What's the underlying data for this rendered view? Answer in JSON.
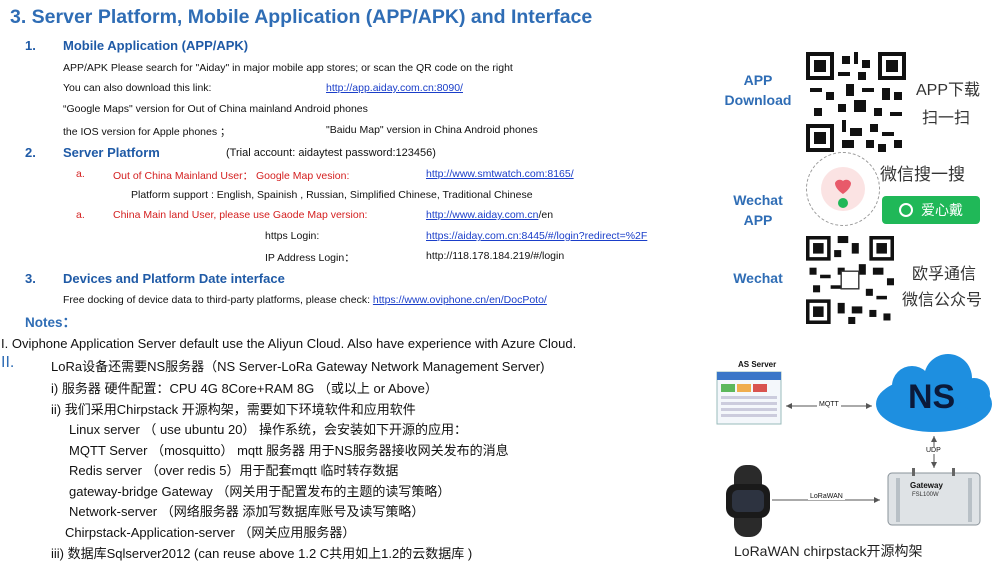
{
  "title": "3. Server Platform, Mobile Application (APP/APK) and Interface",
  "s1": {
    "num": "1.",
    "heading": "Mobile Application (APP/APK)",
    "line1": "APP/APK Please search for \"Aiday\" in major mobile app stores; or scan the QR code on the right",
    "line2_label": "You can also download this link:",
    "line2_link": "http://app.aiday.com.cn:8090/",
    "line3": "“Google Maps\" version for Out of China mainland Android phones",
    "line4a": "the IOS version for Apple phones ；",
    "line4b": "\"Baidu Map\" version in China Android phones"
  },
  "s2": {
    "num": "2.",
    "heading": "Server Platform",
    "trial": "(Trial account:   aidaytest           password:123456)",
    "a1_num": "a.",
    "a1_label": "Out of China Mainland User：  Google Map vesion:",
    "a1_link": "http://www.smtwatch.com:8165/",
    "support": "Platform support : English, Spainish , Russian, Simplified Chinese, Traditional Chinese",
    "a2_num": "a.",
    "a2_label": "China Main land User, please use Gaode Map version:",
    "a2_link": "http://www.aiday.com.cn",
    "a2_suffix": "/en",
    "https_label": "https Login:",
    "https_link": "https://aiday.com.cn:8445/#/login?redirect=%2F",
    "ip_label": "IP Address Login：",
    "ip_value": "http://118.178.184.219/#/login"
  },
  "s3": {
    "num": "3.",
    "heading": "Devices and Platform Date interface",
    "line_label": "Free docking of device data to third-party platforms, please check:",
    "line_link": "https://www.oviphone.cn/en/DocPoto/"
  },
  "notes": {
    "heading": "Notes：",
    "n1": "I.  Oviphone Application Server default use the Aliyun Cloud. Also have experience with Azure Cloud.",
    "n2_num": "II.",
    "n2": "LoRa设备还需要NS服务器（NS Server-LoRa Gateway Network Management Server)",
    "i1": "i)   服务器 硬件配置：CPU 4G 8Core+RAM 8G  （或以上 or Above）",
    "i2": "ii)  我们采用Chirpstack 开源构架，需要如下环境软件和应用软件",
    "l1": "Linux server  （ use ubuntu 20）  操作系统，会安装如下开源的应用：",
    "l2": "MQTT Server  （mosquitto）  mqtt 服务器 用于NS服务器接收网关发布的消息",
    "l3": "Redis server  （over redis 5）用于配套mqtt 临时转存数据",
    "l4": "gateway-bridge Gateway  （网关用于配置发布的主题的读写策略）",
    "l5": "Network-server  （网络服务器 添加写数据库账号及读写策略）",
    "l6": "Chirpstack-Application-server  （网关应用服务器）",
    "i3": "iii) 数据库Sqlserver2012   (can reuse above 1.2 C共用如上1.2的云数据库 )"
  },
  "side": {
    "app_download": "APP Download",
    "app_cn1": "APP下载",
    "app_cn2": "扫一扫",
    "wechat_app": "Wechat APP",
    "wx_search": "微信搜一搜",
    "wx_button": "爱心戴",
    "wechat": "Wechat",
    "wx_cn1": "欧孚通信",
    "wx_cn2": "微信公众号"
  },
  "diagram": {
    "as_server": "AS Server",
    "ns": "NS",
    "mqtt": "MQTT",
    "udp": "UDP",
    "lorawan": "LoRaWAN",
    "gateway": "Gateway",
    "gw_model": "FSL100W",
    "caption": "LoRaWAN chirpstack开源构架"
  },
  "colors": {
    "title_blue": "#2f6db5",
    "link_blue": "#1a3ec9",
    "red": "#d42020",
    "cloud_blue": "#1e8fe0",
    "wx_green": "#20b858"
  }
}
